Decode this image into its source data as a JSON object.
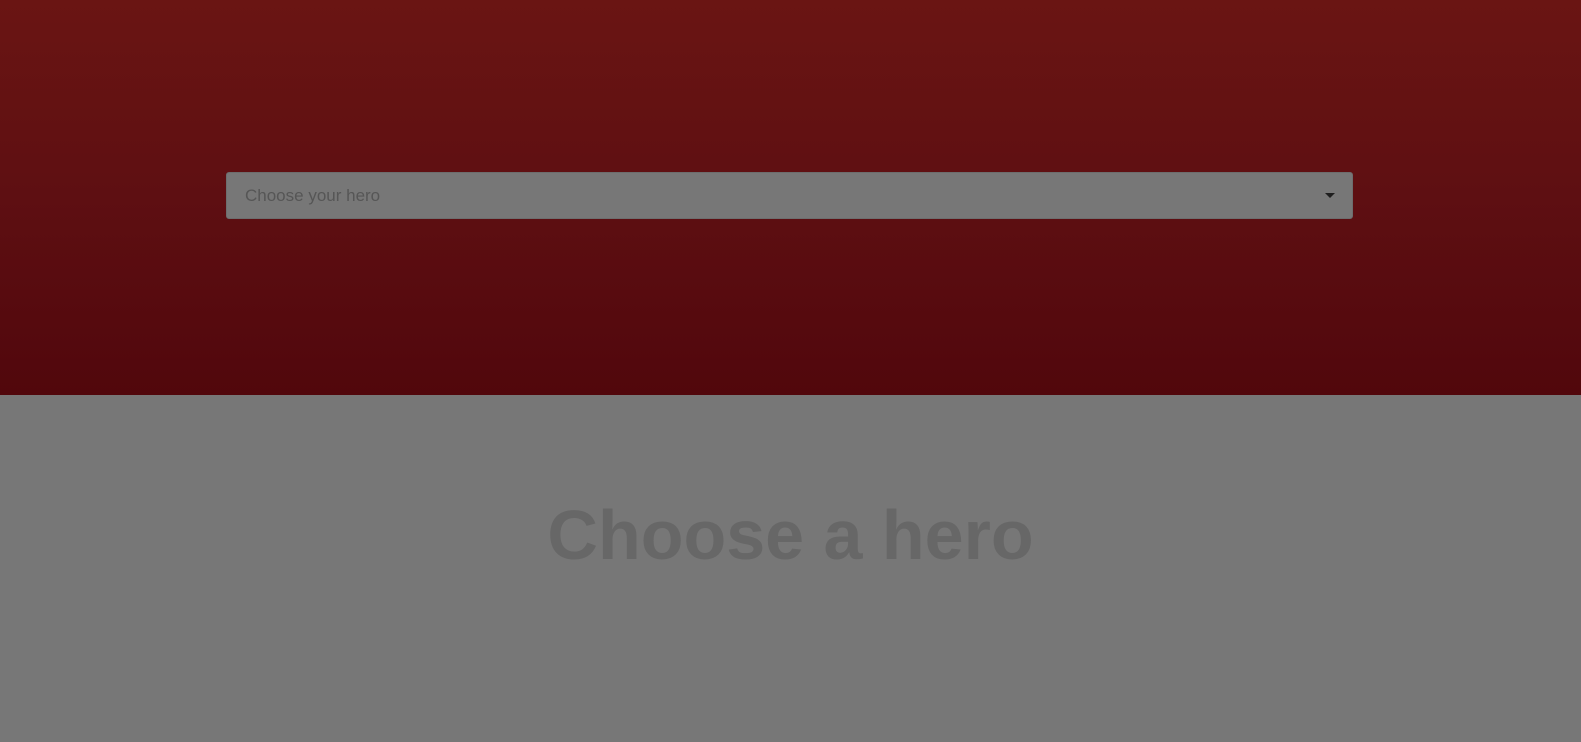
{
  "header": {
    "hero_select": {
      "placeholder": "Choose your hero",
      "icon": "caret-down-icon"
    }
  },
  "main": {
    "empty_title": "Choose a hero"
  },
  "colors": {
    "header_top": "#6a1513",
    "header_bottom": "#51070c",
    "overlay_gray": "#777777",
    "title_text": "#676767",
    "placeholder_text": "#565656"
  }
}
